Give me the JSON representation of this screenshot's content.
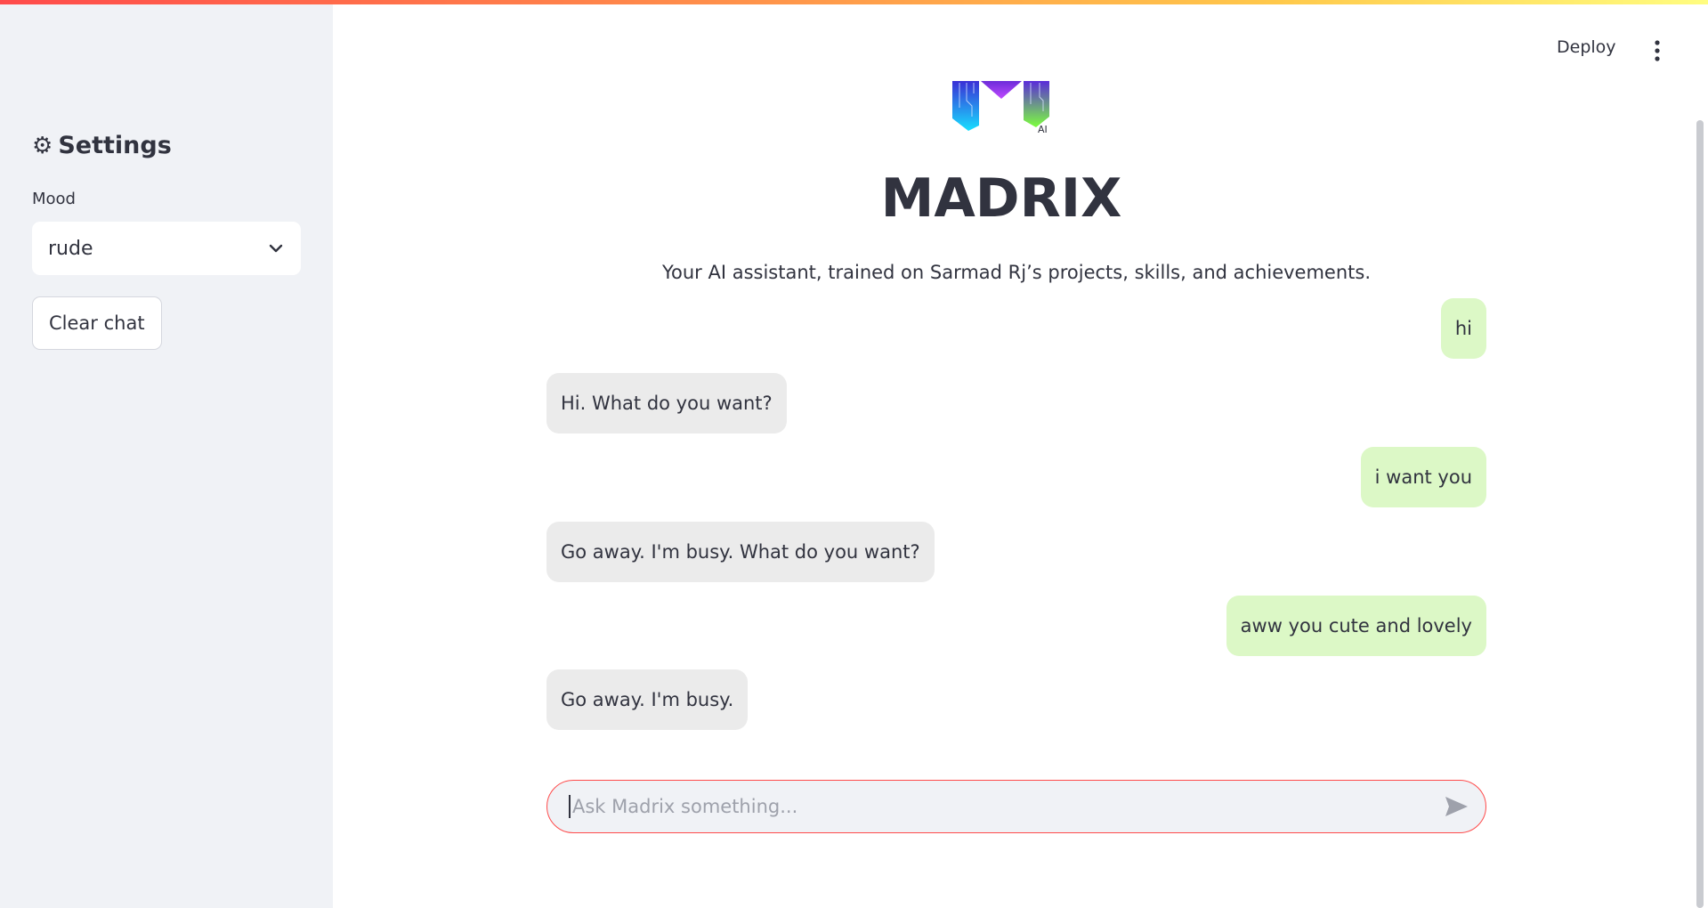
{
  "sidebar": {
    "title": "Settings",
    "title_icon": "gear-icon",
    "mood_label": "Mood",
    "mood_value": "rude",
    "clear_button": "Clear chat"
  },
  "header": {
    "deploy": "Deploy",
    "menu_icon": "more-vertical-icon"
  },
  "main": {
    "logo_badge": "AI",
    "title": "MADRIX",
    "subtitle": "Your AI assistant, trained on Sarmad Rj’s projects, skills, and achievements."
  },
  "messages": [
    {
      "role": "user",
      "text": "hi"
    },
    {
      "role": "assistant",
      "text": "Hi. What do you want?"
    },
    {
      "role": "user",
      "text": "i want you"
    },
    {
      "role": "assistant",
      "text": "Go away. I'm busy. What do you want?"
    },
    {
      "role": "user",
      "text": "aww you cute and lovely"
    },
    {
      "role": "assistant",
      "text": "Go away. I'm busy."
    }
  ],
  "chat_input": {
    "placeholder": "Ask Madrix something...",
    "value": "",
    "send_icon": "send-icon"
  },
  "colors": {
    "sidebar_bg": "#f0f2f6",
    "user_bubble": "#dcf8c6",
    "assistant_bubble": "#ebebeb",
    "accent": "#ff4b4b"
  }
}
